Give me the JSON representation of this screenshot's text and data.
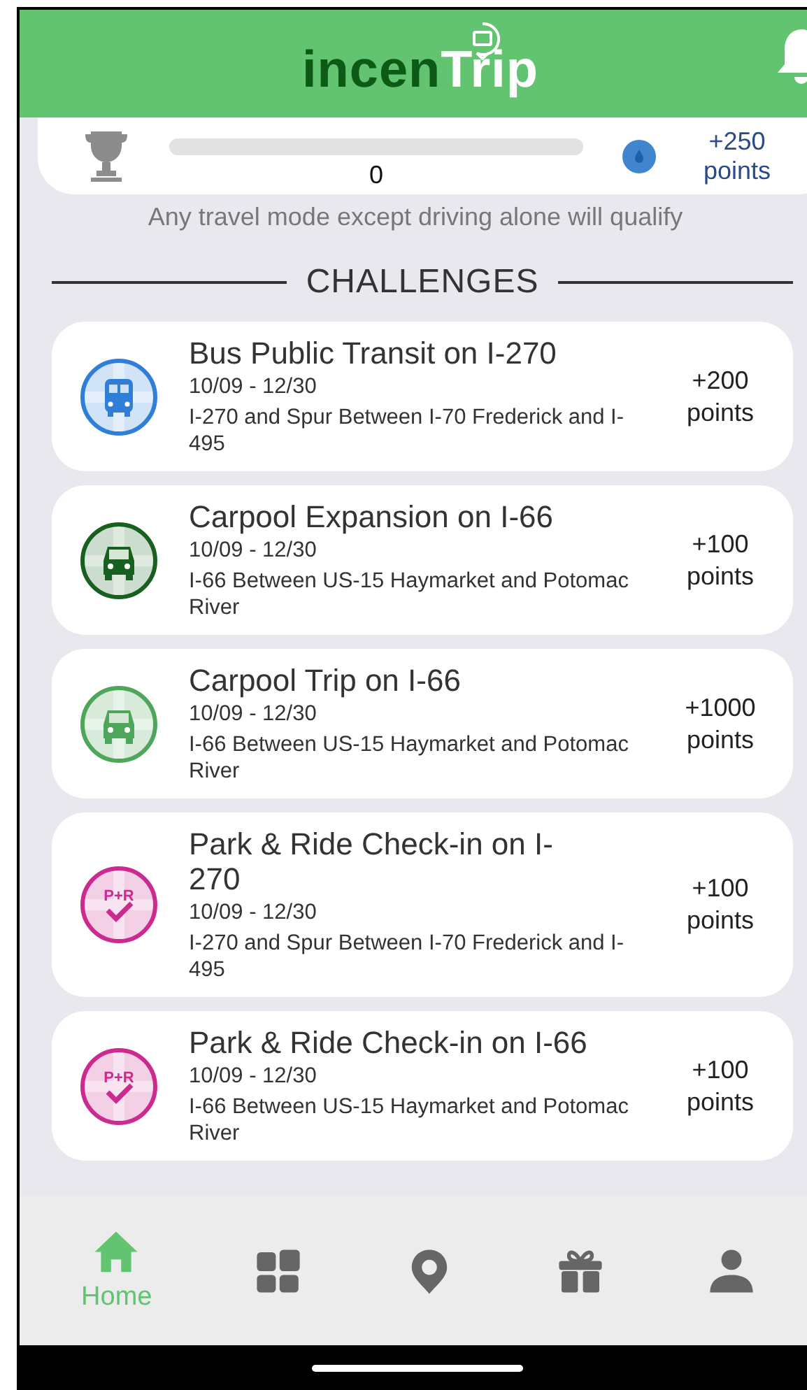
{
  "header": {
    "logo": {
      "first": "incen",
      "second": "Trip"
    }
  },
  "goal": {
    "level": 0,
    "count": "0",
    "reward": "+250 points"
  },
  "subtitle": "Any travel mode except driving alone will qualify",
  "section_title": "CHALLENGES",
  "challenges": [
    {
      "kind": "bus",
      "color": "#2f7fd8",
      "title": "Bus Public Transit on I-270",
      "dates": "10/09  -  12/30",
      "location": "I-270 and Spur Between I-70 Frederick and I-495",
      "points": "+200 points"
    },
    {
      "kind": "carpool",
      "color": "#17601f",
      "title": "Carpool Expansion on I-66",
      "dates": "10/09  -  12/30",
      "location": "I-66 Between US-15 Haymarket and Potomac River",
      "points": "+100 points"
    },
    {
      "kind": "carpool",
      "color": "#4ea65a",
      "title": "Carpool Trip on I-66",
      "dates": "10/09  -  12/30",
      "location": "I-66 Between US-15 Haymarket and Potomac River",
      "points": "+1000 points"
    },
    {
      "kind": "parkride",
      "color": "#cc2a8e",
      "badge": "P+R",
      "title": "Park & Ride Check-in on I-270",
      "dates": "10/09  -  12/30",
      "location": "I-270 and Spur Between I-70 Frederick and I-495",
      "points": "+100 points"
    },
    {
      "kind": "parkride",
      "color": "#cc2a8e",
      "badge": "P+R",
      "title": "Park & Ride Check-in on I-66",
      "dates": "10/09  -  12/30",
      "location": "I-66 Between US-15 Haymarket and Potomac River",
      "points": "+100 points"
    }
  ],
  "nav": [
    {
      "kind": "home",
      "label": "Home",
      "selected": true
    },
    {
      "kind": "grid",
      "selected": false
    },
    {
      "kind": "pin",
      "selected": false
    },
    {
      "kind": "gift",
      "selected": false
    },
    {
      "kind": "person",
      "selected": false
    }
  ]
}
